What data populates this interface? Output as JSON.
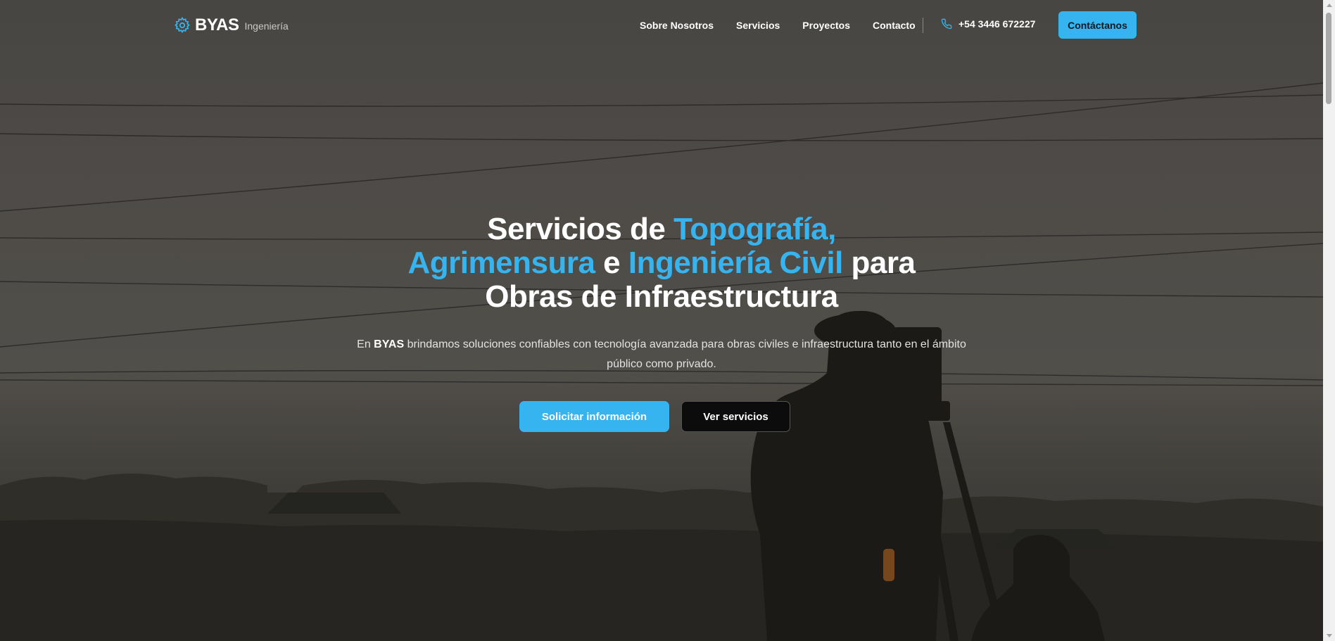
{
  "header": {
    "brand_name": "BYAS",
    "brand_sub": "Ingeniería",
    "nav": [
      "Sobre Nosotros",
      "Servicios",
      "Proyectos",
      "Contacto"
    ],
    "phone": "+54 3446 672227",
    "cta": "Contáctanos"
  },
  "hero": {
    "title_parts": {
      "p1": "Servicios de ",
      "a1": "Topografía,",
      "a2": "Agrimensura",
      "p2": " e ",
      "a3": "Ingeniería Civil",
      "p3": " para",
      "p4": "Obras de Infraestructura"
    },
    "subtitle_pre": "En ",
    "subtitle_brand": "BYAS",
    "subtitle_post": " brindamos soluciones confiables con tecnología avanzada para obras civiles e infraestructura tanto en el ámbito público como privado.",
    "primary_button": "Solicitar información",
    "secondary_button": "Ver servicios"
  },
  "icons": {
    "brand": "gear-icon",
    "phone": "phone-icon"
  },
  "colors": {
    "accent": "#36b4ef",
    "text": "#ffffff",
    "dark_button": "#0c0c0c"
  }
}
